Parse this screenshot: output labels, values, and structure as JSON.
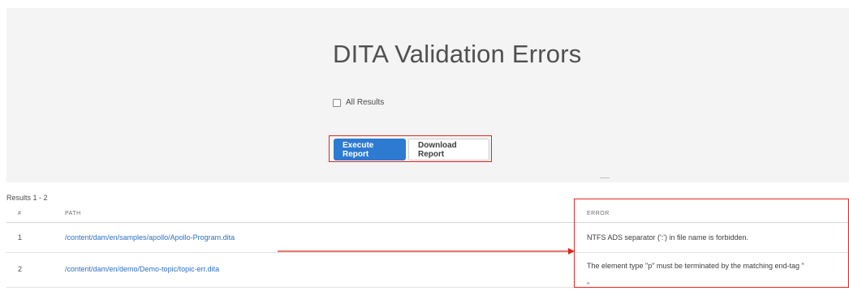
{
  "page": {
    "title": "DITA Validation Errors",
    "all_results_label": "All Results",
    "all_results_checked": false
  },
  "actions": {
    "execute_label": "Execute Report",
    "download_label": "Download Report"
  },
  "results": {
    "count_label": "Results 1 - 2",
    "columns": [
      "#",
      "PATH",
      "ERROR"
    ],
    "rows": [
      {
        "num": "1",
        "path": "/content/dam/en/samples/apollo/Apollo-Program.dita",
        "error": "NTFS ADS separator (':') in file name is forbidden."
      },
      {
        "num": "2",
        "path": "/content/dam/en/demo/Demo-topic/topic-err.dita",
        "error_line1": "The element type \"p\" must be terminated by the matching end-tag \"",
        "error_line2": "\"."
      }
    ]
  },
  "colors": {
    "primary": "#2d7ad1",
    "link": "#2d6fc6",
    "annotation": "#e0261d",
    "panel": "#f4f4f4"
  }
}
